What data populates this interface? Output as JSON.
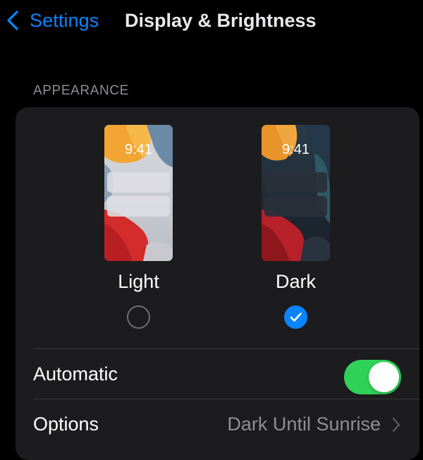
{
  "nav": {
    "back_label": "Settings",
    "title": "Display & Brightness",
    "accent": "#0a84ff"
  },
  "appearance": {
    "header": "APPEARANCE",
    "options": [
      {
        "label": "Light",
        "time": "9:41",
        "selected": false
      },
      {
        "label": "Dark",
        "time": "9:41",
        "selected": true
      }
    ]
  },
  "automatic": {
    "label": "Automatic",
    "enabled": true,
    "toggle_color": "#30d158"
  },
  "options_row": {
    "label": "Options",
    "value": "Dark Until Sunrise"
  },
  "icons": {
    "back": "chevron-left-icon",
    "check": "checkmark-icon",
    "disclosure": "chevron-right-icon"
  }
}
